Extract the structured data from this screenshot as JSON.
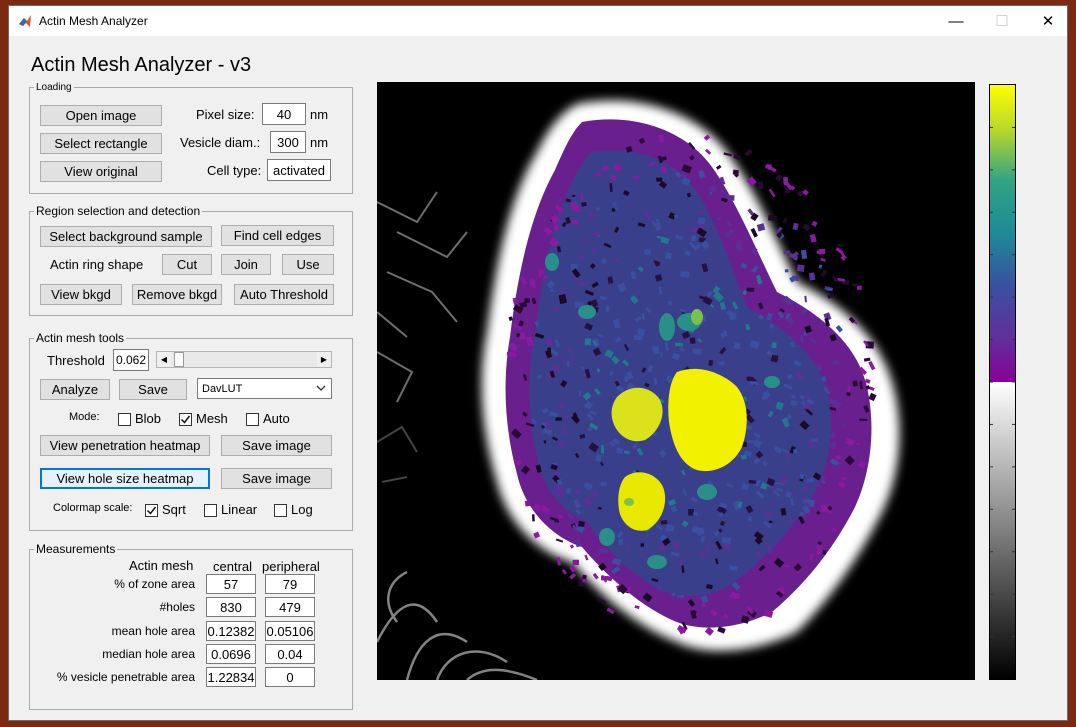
{
  "window": {
    "title": "Actin Mesh Analyzer",
    "minimize": "—",
    "maximize": "☐",
    "close": "✕"
  },
  "app": {
    "title": "Actin Mesh Analyzer  - v3"
  },
  "loading": {
    "legend": "Loading",
    "open_image": "Open image",
    "select_rectangle": "Select rectangle",
    "view_original": "View original",
    "pixel_size_label": "Pixel size:",
    "pixel_size_value": "40",
    "pixel_size_unit": "nm",
    "vesicle_label": "Vesicle diam.:",
    "vesicle_value": "300",
    "vesicle_unit": "nm",
    "cell_type_label": "Cell type:",
    "cell_type_value": "activated"
  },
  "region": {
    "legend": "Region selection and detection",
    "select_bg_sample": "Select background sample",
    "find_cell_edges": "Find cell edges",
    "actin_ring_shape": "Actin ring shape",
    "cut": "Cut",
    "join": "Join",
    "use": "Use",
    "view_bkgd": "View bkgd",
    "remove_bkgd": "Remove bkgd",
    "auto_threshold": "Auto Threshold"
  },
  "mesh": {
    "legend": "Actin mesh tools",
    "threshold_label": "Threshold",
    "threshold_value": "0.062",
    "threshold_fraction": 0.02,
    "analyze": "Analyze",
    "save": "Save",
    "lut_selected": "DavLUT",
    "mode_label": "Mode:",
    "mode_options": [
      {
        "label": "Blob",
        "checked": false
      },
      {
        "label": "Mesh",
        "checked": true
      },
      {
        "label": "Auto",
        "checked": false
      }
    ],
    "view_penetration": "View penetration heatmap",
    "save_image_1": "Save image",
    "view_hole_size": "View hole size heatmap",
    "save_image_2": "Save image",
    "colormap_label": "Colormap scale:",
    "colormap_options": [
      {
        "label": "Sqrt",
        "checked": true
      },
      {
        "label": "Linear",
        "checked": false
      },
      {
        "label": "Log",
        "checked": false
      }
    ]
  },
  "measurements": {
    "legend": "Measurements",
    "header": {
      "name": "Actin mesh",
      "central": "central",
      "peripheral": "peripheral"
    },
    "rows": [
      {
        "label": "% of zone area",
        "central": "57",
        "peripheral": "79"
      },
      {
        "label": "#holes",
        "central": "830",
        "peripheral": "479"
      },
      {
        "label": "mean hole area",
        "central": "0.12382",
        "peripheral": "0.05106"
      },
      {
        "label": "median hole area",
        "central": "0.0696",
        "peripheral": "0.04"
      },
      {
        "label": "% vesicle penetrable area",
        "central": "1.22834",
        "peripheral": "0"
      }
    ]
  },
  "colors": {
    "colorbar_top": "#ffff00",
    "colorbar_mid_teal": "#22998a",
    "colorbar_blue": "#3a4fa0",
    "colorbar_purple": "#880099",
    "outer_white": "#ffffff",
    "background": "#000000"
  },
  "icons": {
    "app": "matlab-icon",
    "dropdown": "chevron-down-icon",
    "slider_left": "arrow-left-icon",
    "slider_right": "arrow-right-icon",
    "check": "check-icon"
  }
}
